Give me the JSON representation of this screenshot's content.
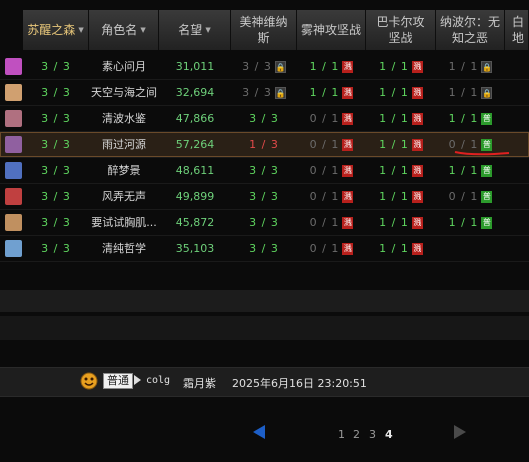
{
  "columns": [
    {
      "label": "苏醒之森",
      "sorted": true
    },
    {
      "label": "角色名"
    },
    {
      "label": "名望"
    },
    {
      "label": "美神维纳斯"
    },
    {
      "label": "雾神攻坚战"
    },
    {
      "label": "巴卡尔攻坚战"
    },
    {
      "label": "纳波尔：无知之恶"
    },
    {
      "label": "白地"
    }
  ],
  "rows": [
    {
      "avatar_color": "#c050c0",
      "progress": "3 / 3",
      "name": "素心问月",
      "fame": "31,011",
      "venus": "3 / 3",
      "venus_state": "gray",
      "venus_mark": "lock",
      "fog": "1 / 1",
      "fog_state": "green",
      "fog_mark": "red",
      "bakal": "1 / 1",
      "bakal_state": "green",
      "bakal_mark": "red",
      "nabol": "1 / 1",
      "nabol_state": "gray",
      "nabol_mark": "lock"
    },
    {
      "avatar_color": "#d0a070",
      "progress": "3 / 3",
      "name": "天空与海之间",
      "fame": "32,694",
      "venus": "3 / 3",
      "venus_state": "gray",
      "venus_mark": "lock",
      "fog": "1 / 1",
      "fog_state": "green",
      "fog_mark": "red",
      "bakal": "1 / 1",
      "bakal_state": "green",
      "bakal_mark": "red",
      "nabol": "1 / 1",
      "nabol_state": "gray",
      "nabol_mark": "lock"
    },
    {
      "avatar_color": "#b07080",
      "progress": "3 / 3",
      "name": "清波水鉴",
      "fame": "47,866",
      "venus": "3 / 3",
      "venus_state": "green",
      "venus_mark": "",
      "fog": "0 / 1",
      "fog_state": "gray",
      "fog_mark": "red",
      "bakal": "1 / 1",
      "bakal_state": "green",
      "bakal_mark": "red",
      "nabol": "1 / 1",
      "nabol_state": "green",
      "nabol_mark": "green"
    },
    {
      "avatar_color": "#9060a0",
      "progress": "3 / 3",
      "name": "雨过河源",
      "fame": "57,264",
      "venus": "1 / 3",
      "venus_state": "red",
      "venus_mark": "",
      "fog": "0 / 1",
      "fog_state": "gray",
      "fog_mark": "red",
      "bakal": "1 / 1",
      "bakal_state": "green",
      "bakal_mark": "red",
      "nabol": "0 / 1",
      "nabol_state": "gray",
      "nabol_mark": "green",
      "highlight": true
    },
    {
      "avatar_color": "#5070c0",
      "progress": "3 / 3",
      "name": "醉梦景",
      "fame": "48,611",
      "venus": "3 / 3",
      "venus_state": "green",
      "venus_mark": "",
      "fog": "0 / 1",
      "fog_state": "gray",
      "fog_mark": "red",
      "bakal": "1 / 1",
      "bakal_state": "green",
      "bakal_mark": "red",
      "nabol": "1 / 1",
      "nabol_state": "green",
      "nabol_mark": "green"
    },
    {
      "avatar_color": "#c04040",
      "progress": "3 / 3",
      "name": "风弄无声",
      "fame": "49,899",
      "venus": "3 / 3",
      "venus_state": "green",
      "venus_mark": "",
      "fog": "0 / 1",
      "fog_state": "gray",
      "fog_mark": "red",
      "bakal": "1 / 1",
      "bakal_state": "green",
      "bakal_mark": "red",
      "nabol": "0 / 1",
      "nabol_state": "gray",
      "nabol_mark": "green"
    },
    {
      "avatar_color": "#c09060",
      "progress": "3 / 3",
      "name": "要试试胸肌...",
      "fame": "45,872",
      "venus": "3 / 3",
      "venus_state": "green",
      "venus_mark": "",
      "fog": "0 / 1",
      "fog_state": "gray",
      "fog_mark": "red",
      "bakal": "1 / 1",
      "bakal_state": "green",
      "bakal_mark": "red",
      "nabol": "1 / 1",
      "nabol_state": "green",
      "nabol_mark": "green"
    },
    {
      "avatar_color": "#70a0d0",
      "progress": "3 / 3",
      "name": "清纯哲学",
      "fame": "35,103",
      "venus": "3 / 3",
      "venus_state": "green",
      "venus_mark": "",
      "fog": "0 / 1",
      "fog_state": "gray",
      "fog_mark": "red",
      "bakal": "1 / 1",
      "bakal_state": "green",
      "bakal_mark": "red",
      "nabol": "",
      "nabol_state": "gray",
      "nabol_mark": ""
    }
  ],
  "mark_glyphs": {
    "red": "溅",
    "lock": "🔒",
    "green": "普"
  },
  "chat": {
    "channel": "普通",
    "user": "colg",
    "nickname": "霜月紫",
    "timestamp": "2025年6月16日 23:20:51"
  },
  "pager": {
    "pages": [
      "1",
      "2",
      "3",
      "4"
    ],
    "current": "4"
  },
  "colors": {
    "accent_green": "#5fd65f",
    "accent_red": "#e24a4a",
    "prev_arrow": "#1d5fc8",
    "annotation_underline": "#e02020"
  }
}
